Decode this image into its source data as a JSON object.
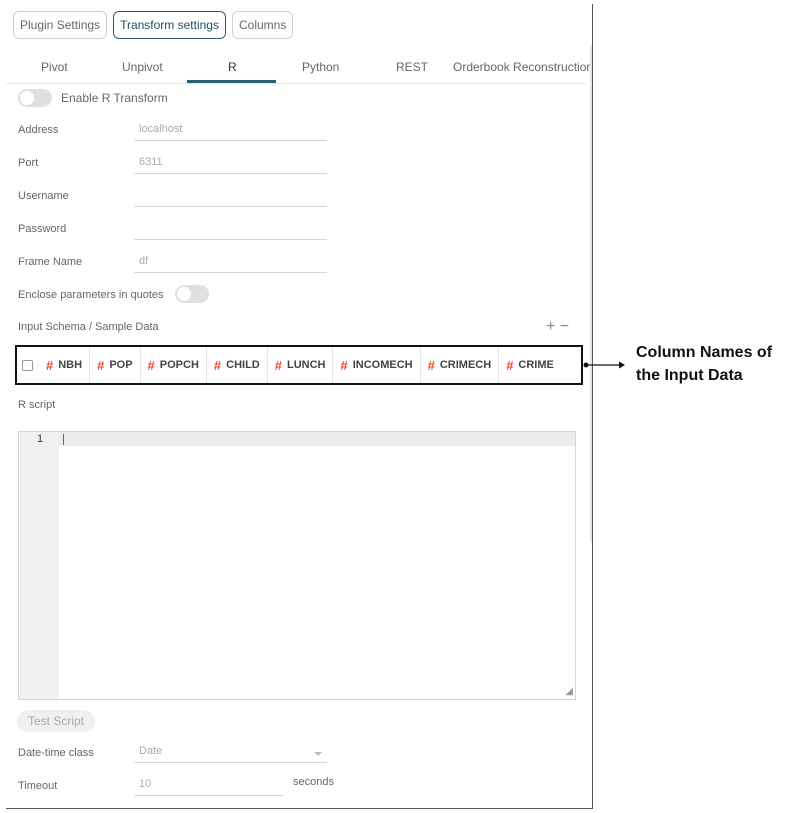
{
  "top_tabs": [
    "Plugin Settings",
    "Transform settings",
    "Columns"
  ],
  "sub_tabs": [
    "Pivot",
    "Unpivot",
    "R",
    "Python",
    "REST",
    "Orderbook Reconstruction"
  ],
  "enable_label": "Enable R Transform",
  "fields": {
    "address": {
      "label": "Address",
      "value": "localhost"
    },
    "port": {
      "label": "Port",
      "value": "6311"
    },
    "username": {
      "label": "Username",
      "value": ""
    },
    "password": {
      "label": "Password",
      "value": ""
    },
    "frame_name": {
      "label": "Frame Name",
      "value": "df"
    }
  },
  "enclose_label": "Enclose parameters in quotes",
  "schema_label": "Input Schema / Sample Data",
  "plus": "+",
  "minus": "−",
  "columns": [
    "NBH",
    "POP",
    "POPCH",
    "CHILD",
    "LUNCH",
    "INCOMECH",
    "CRIMECH",
    "CRIME"
  ],
  "hash": "#",
  "rscript_label": "R script",
  "line_number": "1",
  "test_button": "Test Script",
  "datetime": {
    "label": "Date-time class",
    "value": "Date"
  },
  "timeout": {
    "label": "Timeout",
    "value": "10",
    "unit": "seconds"
  },
  "annotation": "Column Names of the Input Data"
}
